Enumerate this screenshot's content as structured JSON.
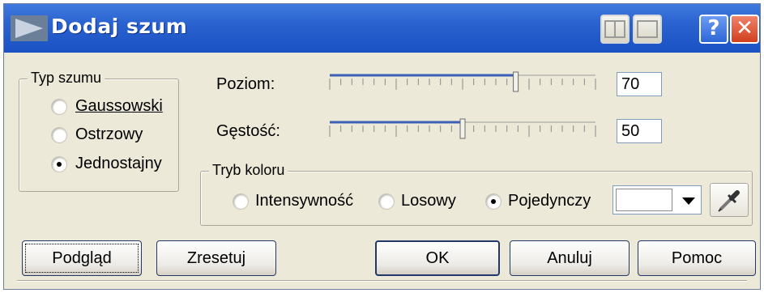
{
  "window": {
    "title": "Dodaj szum",
    "buttons": {
      "help": "?",
      "close": "✕"
    }
  },
  "noise_type": {
    "title": "Typ szumu",
    "options": [
      {
        "label": "Gaussowski",
        "selected": false
      },
      {
        "label": "Ostrzowy",
        "selected": false
      },
      {
        "label": "Jednostajny",
        "selected": true
      }
    ]
  },
  "sliders": {
    "level": {
      "label": "Poziom:",
      "value": "70",
      "fraction": 0.7
    },
    "density": {
      "label": "Gęstość:",
      "value": "50",
      "fraction": 0.5
    }
  },
  "color_mode": {
    "title": "Tryb koloru",
    "options": [
      {
        "label": "Intensywność",
        "selected": false
      },
      {
        "label": "Losowy",
        "selected": false
      },
      {
        "label": "Pojedynczy",
        "selected": true
      }
    ],
    "swatch_color": "#ffffff",
    "picker_icon": "eyedropper-icon"
  },
  "buttons": {
    "preview": "Podgląd",
    "reset": "Zresetuj",
    "ok": "OK",
    "cancel": "Anuluj",
    "help": "Pomoc"
  },
  "colors": {
    "titlebar": "#2a62cf",
    "window_bg": "#ece9d8",
    "slider_fill": "#3a5fb5"
  }
}
